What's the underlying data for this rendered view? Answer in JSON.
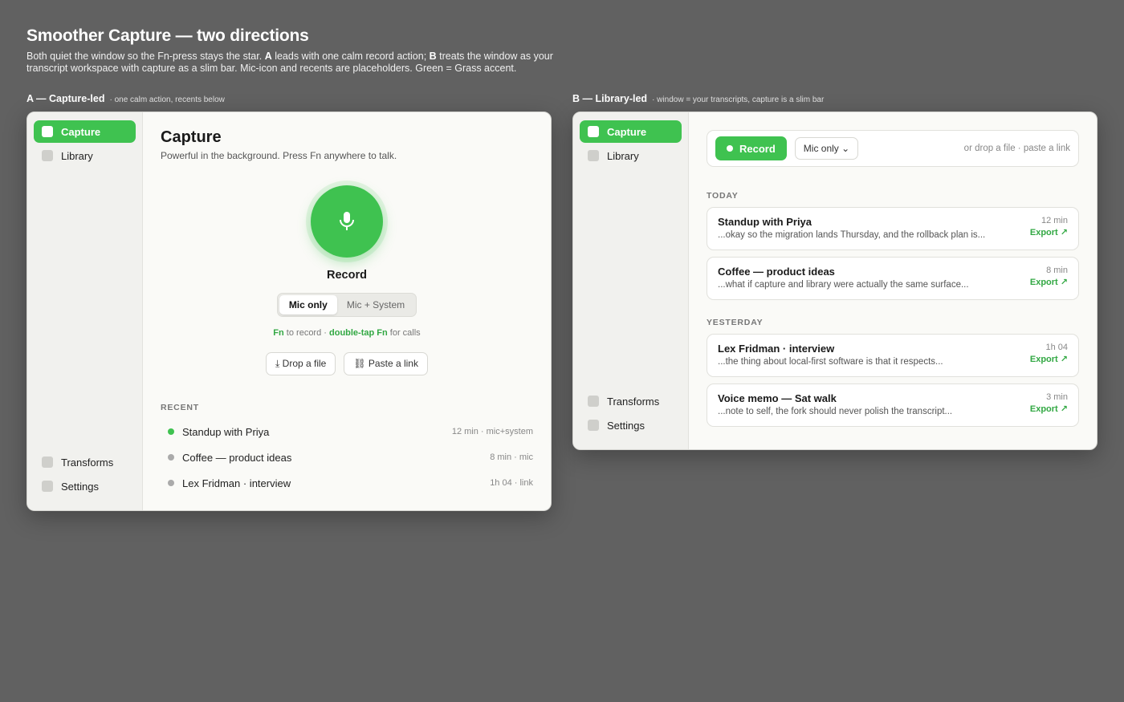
{
  "header": {
    "title": "Smoother Capture — two directions",
    "desc_part1": "Both quiet the window so the Fn-press stays the star. ",
    "desc_a": "A",
    "desc_part2": " leads with one calm record action; ",
    "desc_b": "B",
    "desc_part3": " treats the window as your transcript workspace with capture as a slim bar. Mic-icon and recents are placeholders. Green = Grass accent."
  },
  "variant_a": {
    "label": "A — Capture-led",
    "sublabel": "· one calm action, recents below",
    "sidebar": {
      "items": [
        {
          "label": "Capture"
        },
        {
          "label": "Library"
        },
        {
          "label": "Transforms"
        },
        {
          "label": "Settings"
        }
      ]
    },
    "title": "Capture",
    "subtitle": "Powerful in the background. Press Fn anywhere to talk.",
    "record_label": "Record",
    "seg": [
      "Mic only",
      "Mic + System"
    ],
    "hint": {
      "k1": "Fn",
      "t1": " to record · ",
      "k2": "double-tap Fn",
      "t2": " for calls"
    },
    "drop_file": "⤓ Drop a file",
    "paste_link": "⛓ Paste a link",
    "recent_head": "RECENT",
    "recent": [
      {
        "title": "Standup with Priya",
        "meta": "12 min · mic+system"
      },
      {
        "title": "Coffee — product ideas",
        "meta": "8 min · mic"
      },
      {
        "title": "Lex Fridman · interview",
        "meta": "1h 04 · link"
      }
    ]
  },
  "variant_b": {
    "label": "B — Library-led",
    "sublabel": "· window = your transcripts, capture is a slim bar",
    "sidebar": {
      "items": [
        {
          "label": "Capture"
        },
        {
          "label": "Library"
        },
        {
          "label": "Transforms"
        },
        {
          "label": "Settings"
        }
      ]
    },
    "record_label": "Record",
    "mic_select": "Mic only ⌄",
    "bar_hint": "or drop a file · paste a link",
    "today_head": "TODAY",
    "yesterday_head": "YESTERDAY",
    "today": [
      {
        "title": "Standup with Priya",
        "snippet": "...okay so the migration lands Thursday, and the rollback plan is...",
        "duration": "12 min",
        "export": "Export ↗"
      },
      {
        "title": "Coffee — product ideas",
        "snippet": "...what if capture and library were actually the same surface...",
        "duration": "8 min",
        "export": "Export ↗"
      }
    ],
    "yesterday": [
      {
        "title": "Lex Fridman · interview",
        "snippet": "...the thing about local-first software is that it respects...",
        "duration": "1h 04",
        "export": "Export ↗"
      },
      {
        "title": "Voice memo — Sat walk",
        "snippet": "...note to self, the fork should never polish the transcript...",
        "duration": "3 min",
        "export": "Export ↗"
      }
    ]
  },
  "colors": {
    "accent": "#3fc250",
    "background": "#616161"
  }
}
